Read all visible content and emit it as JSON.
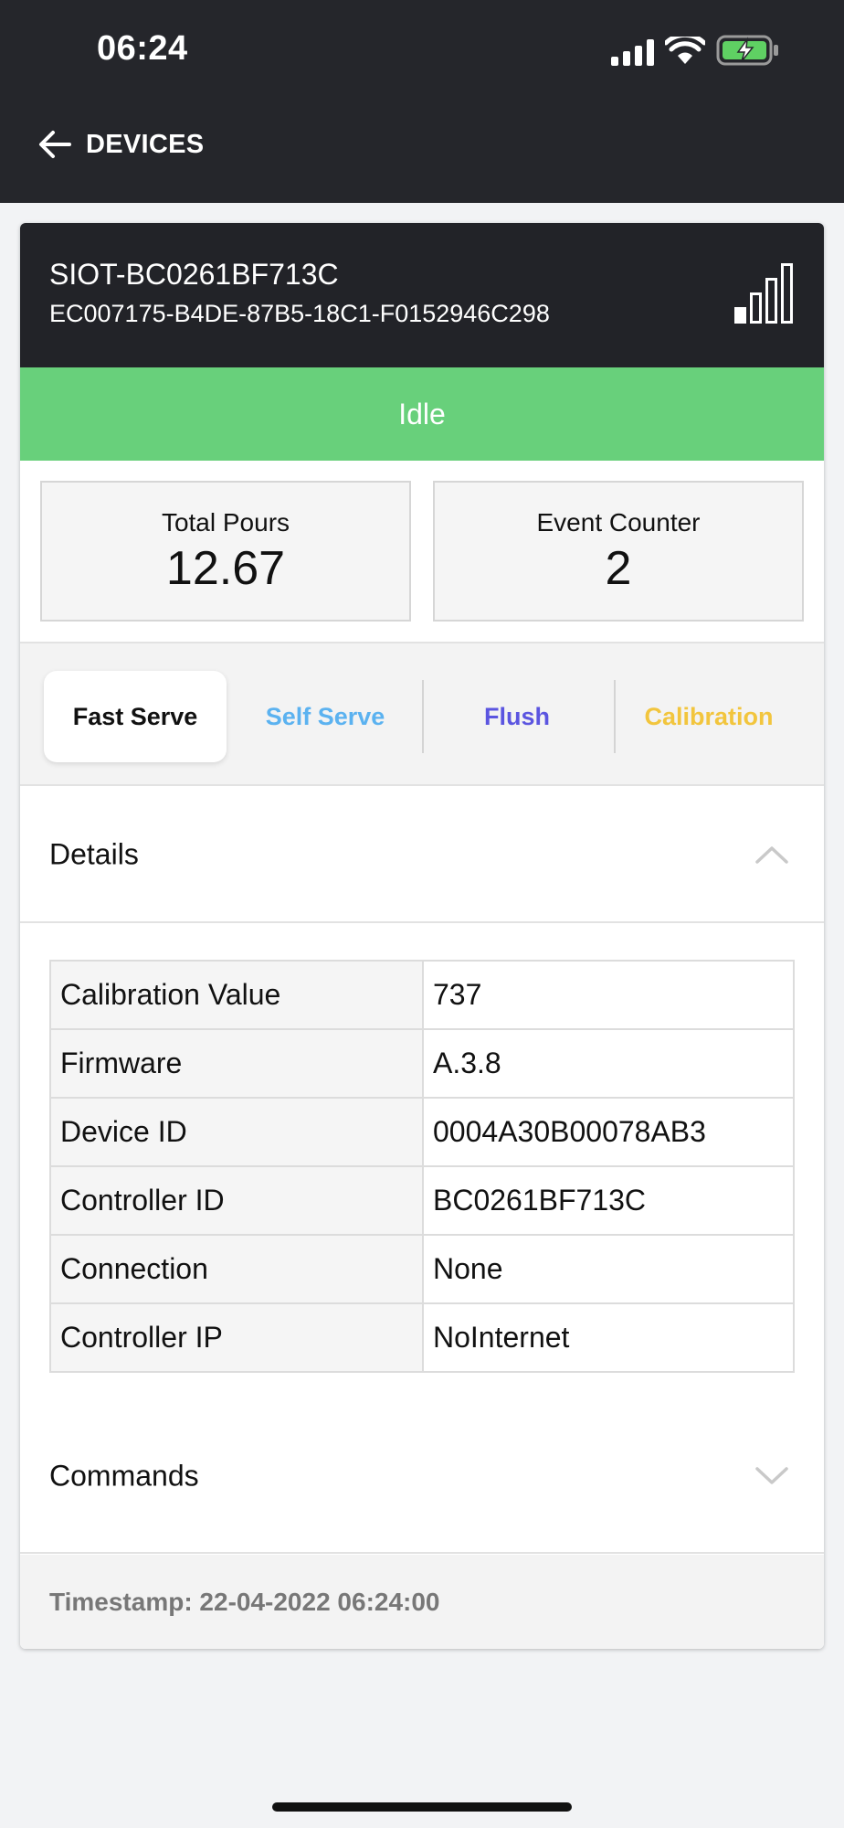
{
  "status_bar": {
    "time": "06:24"
  },
  "nav": {
    "back_label": "DEVICES"
  },
  "device": {
    "name": "SIOT-BC0261BF713C",
    "uuid": "EC007175-B4DE-87B5-18C1-F0152946C298",
    "signal_level": "1 of 4 bars"
  },
  "status": {
    "label": "Idle",
    "color": "#68d07b"
  },
  "stats": [
    {
      "label": "Total Pours",
      "value": "12.67"
    },
    {
      "label": "Event Counter",
      "value": "2"
    }
  ],
  "tabs": [
    {
      "label": "Fast Serve",
      "color": "#111111",
      "active": true
    },
    {
      "label": "Self Serve",
      "color": "#5bb2f0",
      "active": false
    },
    {
      "label": "Flush",
      "color": "#5b55e0",
      "active": false
    },
    {
      "label": "Calibration",
      "color": "#f2c53d",
      "active": false
    }
  ],
  "details": {
    "title": "Details",
    "expanded": true,
    "rows": [
      {
        "key": "Calibration Value",
        "value": "737"
      },
      {
        "key": "Firmware",
        "value": "A.3.8"
      },
      {
        "key": "Device ID",
        "value": "0004A30B00078AB3"
      },
      {
        "key": "Controller ID",
        "value": "BC0261BF713C"
      },
      {
        "key": "Connection",
        "value": "None"
      },
      {
        "key": "Controller IP",
        "value": "NoInternet"
      }
    ]
  },
  "commands": {
    "title": "Commands",
    "expanded": false
  },
  "footer": {
    "timestamp": "Timestamp: 22-04-2022 06:24:00"
  }
}
